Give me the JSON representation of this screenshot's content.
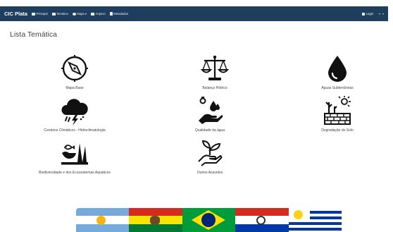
{
  "navbar": {
    "brand": "CIC Plata",
    "items": [
      {
        "label": "Principal",
        "icon": "home-icon"
      },
      {
        "label": "Temática",
        "icon": "list-icon"
      },
      {
        "label": "Mapa ▾",
        "icon": "globe-icon"
      },
      {
        "label": "Arquivo",
        "icon": "folder-icon"
      },
      {
        "label": "Metadados",
        "icon": "file-icon"
      }
    ],
    "login": "Login",
    "extras": [
      "▾",
      "▾"
    ],
    "bg_color": "#1f3d5c"
  },
  "page_title": "Lista Temática",
  "tiles": [
    {
      "label": "Mapa Base",
      "icon": "compass-icon"
    },
    {
      "label": "Balanço Hídrico",
      "icon": "balance-scale-icon"
    },
    {
      "label": "Águas Subterrâneas",
      "icon": "water-drop-icon"
    },
    {
      "label": "Cenários Climáticos - Hidroclimatologia",
      "icon": "storm-cloud-icon"
    },
    {
      "label": "Qualidade da água",
      "icon": "water-quality-icon"
    },
    {
      "label": "Degradação do Solo",
      "icon": "soil-degradation-icon"
    },
    {
      "label": "Biodiversidade e dos Ecossistemas Aquáticos",
      "icon": "biodiversity-icon"
    },
    {
      "label": "Outros Assuntos",
      "icon": "plant-hand-icon"
    }
  ],
  "flags": [
    "Argentina",
    "Bolivia",
    "Brasil",
    "Paraguay",
    "Uruguay"
  ]
}
